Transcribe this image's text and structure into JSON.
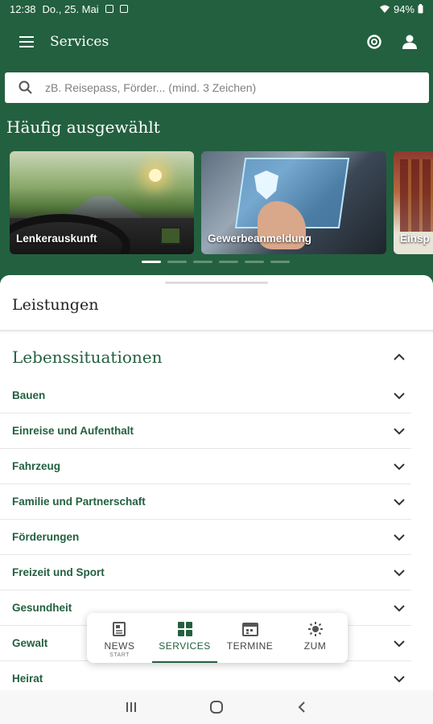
{
  "status_bar": {
    "time": "12:38",
    "date": "Do., 25. Mai",
    "battery": "94%"
  },
  "app_bar": {
    "title": "Services"
  },
  "search": {
    "placeholder": "zB. Reisepass, Förder... (mind. 3 Zeichen)"
  },
  "featured": {
    "heading": "Häufig ausgewählt",
    "cards": [
      {
        "label": "Lenkerauskunft"
      },
      {
        "label": "Gewerbeanmeldung"
      },
      {
        "label": "Einsp"
      }
    ],
    "active_dot": 1,
    "dot_count": 6
  },
  "sheet": {
    "title": "Leistungen",
    "section_title": "Lebenssituationen",
    "items": [
      {
        "label": "Bauen"
      },
      {
        "label": "Einreise und Aufenthalt"
      },
      {
        "label": "Fahrzeug"
      },
      {
        "label": "Familie und Partnerschaft"
      },
      {
        "label": "Förderungen"
      },
      {
        "label": "Freizeit und Sport"
      },
      {
        "label": "Gesundheit"
      },
      {
        "label": "Gewalt"
      },
      {
        "label": "Heirat"
      }
    ]
  },
  "bottom_nav": {
    "items": [
      {
        "label": "NEWS",
        "sub": "START",
        "icon": "newspaper-icon"
      },
      {
        "label": "SERVICES",
        "icon": "grid-icon",
        "active": true
      },
      {
        "label": "TERMINE",
        "icon": "calendar-icon"
      },
      {
        "label": "ZUM",
        "icon": "sun-icon"
      }
    ]
  },
  "colors": {
    "primary": "#23603f",
    "text": "#222222"
  }
}
